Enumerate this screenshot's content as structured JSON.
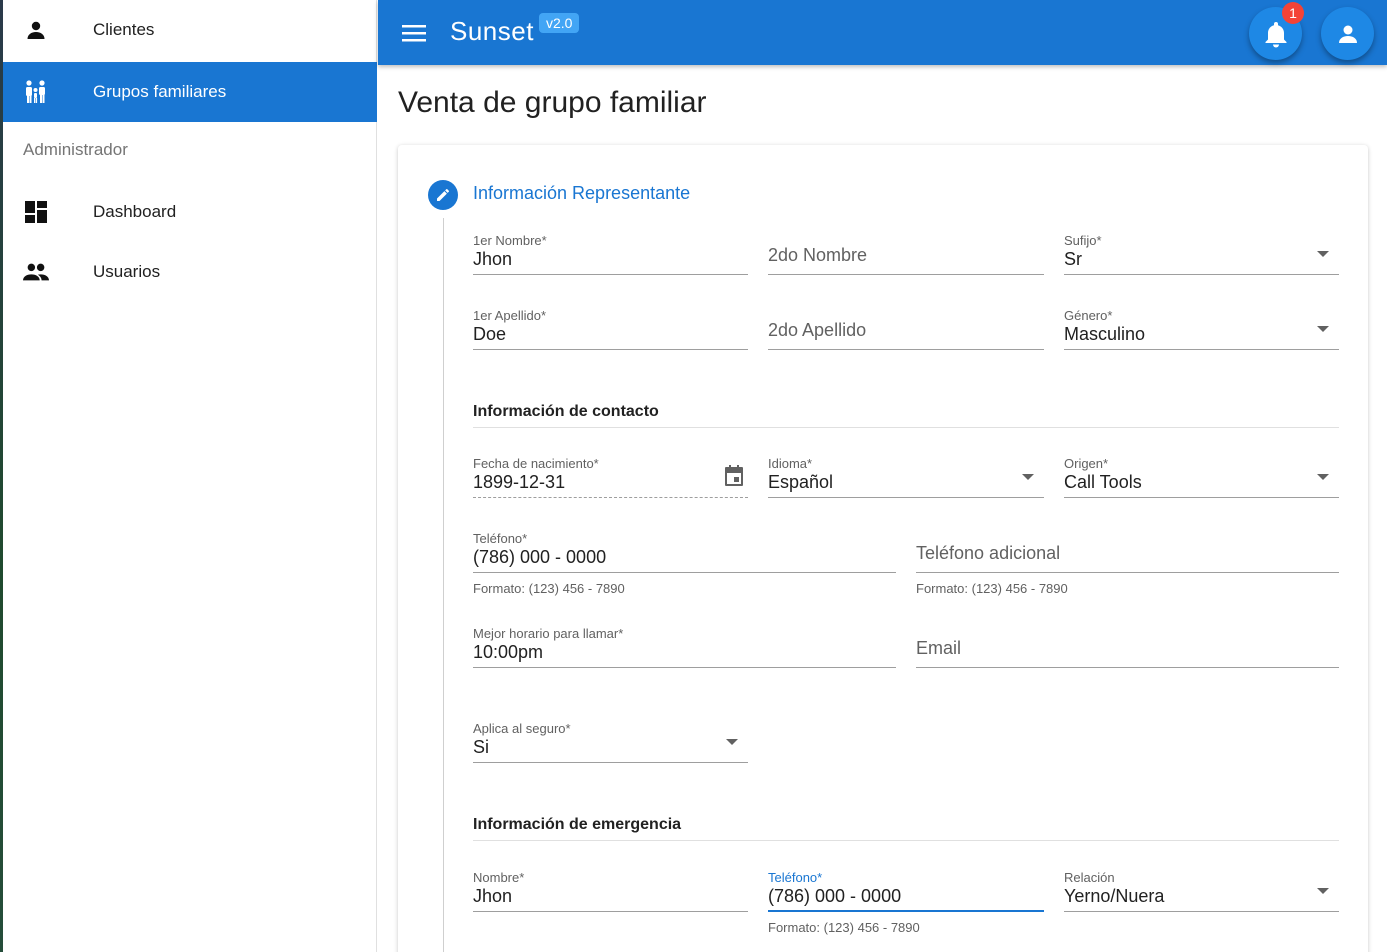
{
  "sidebar": {
    "items": [
      {
        "label": "Clientes",
        "icon": "person-icon"
      },
      {
        "label": "Grupos familiares",
        "icon": "family-icon",
        "active": true
      }
    ],
    "admin_header": "Administrador",
    "admin_items": [
      {
        "label": "Dashboard",
        "icon": "dashboard-icon"
      },
      {
        "label": "Usuarios",
        "icon": "people-icon"
      }
    ]
  },
  "appbar": {
    "title": "Sunset",
    "version": "v2.0",
    "notification_count": "1"
  },
  "page": {
    "title": "Venta de grupo familiar"
  },
  "step": {
    "title": "Información Representante"
  },
  "representative": {
    "first_name": {
      "label": "1er Nombre*",
      "value": "Jhon"
    },
    "second_name": {
      "placeholder": "2do Nombre"
    },
    "suffix": {
      "label": "Sufijo*",
      "value": "Sr"
    },
    "first_lastname": {
      "label": "1er Apellido*",
      "value": "Doe"
    },
    "second_lastname": {
      "placeholder": "2do Apellido"
    },
    "gender": {
      "label": "Género*",
      "value": "Masculino"
    }
  },
  "contact": {
    "section_title": "Información de contacto",
    "birthdate": {
      "label": "Fecha de nacimiento*",
      "value": "1899-12-31"
    },
    "language": {
      "label": "Idioma*",
      "value": "Español"
    },
    "origin": {
      "label": "Origen*",
      "value": "Call Tools"
    },
    "phone": {
      "label": "Teléfono*",
      "value": "(786) 000 - 0000",
      "hint": "Formato: (123) 456 - 7890"
    },
    "extra_phone": {
      "placeholder": "Teléfono adicional",
      "hint": "Formato: (123) 456 - 7890"
    },
    "best_time": {
      "label": "Mejor horario para llamar*",
      "value": "10:00pm"
    },
    "email": {
      "placeholder": "Email"
    },
    "insurance": {
      "label": "Aplica al seguro*",
      "value": "Si"
    }
  },
  "emergency": {
    "section_title": "Información de emergencia",
    "name": {
      "label": "Nombre*",
      "value": "Jhon"
    },
    "phone": {
      "label": "Teléfono*",
      "value": "(786) 000 - 0000",
      "hint": "Formato: (123) 456 - 7890"
    },
    "relation": {
      "label": "Relación",
      "value": "Yerno/Nuera"
    }
  },
  "colors": {
    "primary": "#1976d2",
    "badge": "#f44336"
  }
}
